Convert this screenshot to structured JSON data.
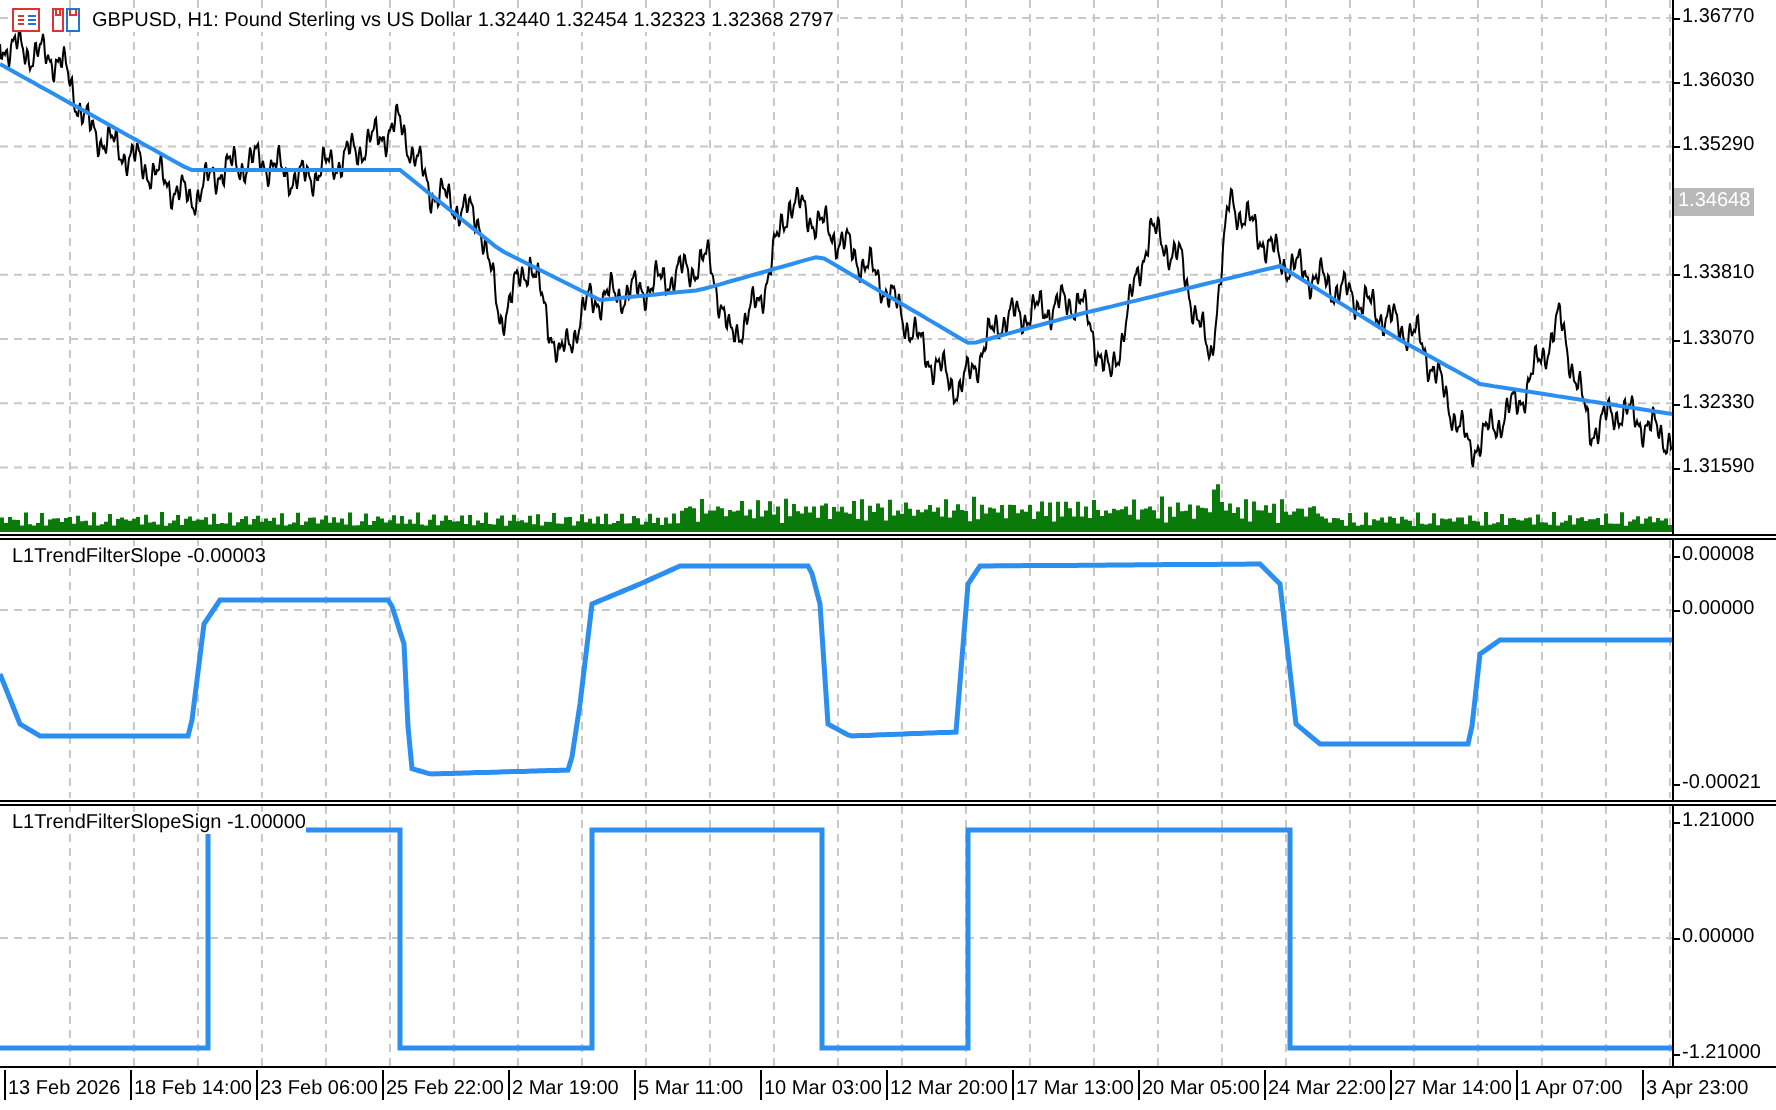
{
  "chart_header": {
    "title": "GBPUSD, H1:  Pound Sterling vs US Dollar  1.32440 1.32454 1.32323 1.32368  2797"
  },
  "price_pane": {
    "ticks": [
      "1.36770",
      "1.36030",
      "1.35290",
      "1.33810",
      "1.33070",
      "1.32330",
      "1.31590"
    ],
    "current_price": "1.34648"
  },
  "indicator_panes": [
    {
      "label": "L1TrendFilterSlope -0.00003",
      "ticks": [
        "0.00008",
        "0.00000",
        "-0.00021"
      ],
      "kind": "curve"
    },
    {
      "label": "L1TrendFilterSlopeSign -1.00000",
      "ticks": [
        "1.21000",
        "0.00000",
        "-1.21000"
      ],
      "kind": "steps"
    }
  ],
  "time_axis": [
    "13 Feb 2026",
    "18 Feb 14:00",
    "23 Feb 06:00",
    "25 Feb 22:00",
    "2 Mar 19:00",
    "5 Mar 11:00",
    "10 Mar 03:00",
    "12 Mar 20:00",
    "17 Mar 13:00",
    "20 Mar 05:00",
    "24 Mar 22:00",
    "27 Mar 14:00",
    "1 Apr 07:00",
    "3 Apr 23:00"
  ]
}
